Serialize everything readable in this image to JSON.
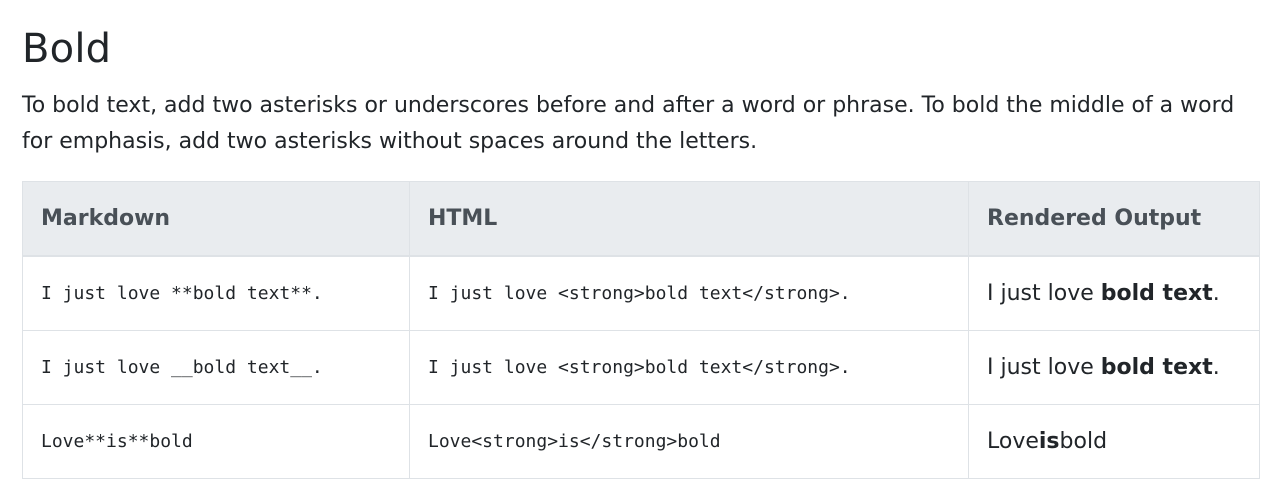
{
  "heading": "Bold",
  "intro": "To bold text, add two asterisks or underscores before and after a word or phrase. To bold the middle of a word for emphasis, add two asterisks without spaces around the letters.",
  "table": {
    "headers": [
      "Markdown",
      "HTML",
      "Rendered Output"
    ],
    "rows": [
      {
        "markdown": "I just love **bold text**.",
        "html": "I just love <strong>bold text</strong>.",
        "rendered": {
          "before": "I just love ",
          "bold": "bold text",
          "after": "."
        }
      },
      {
        "markdown": "I just love __bold text__.",
        "html": "I just love <strong>bold text</strong>.",
        "rendered": {
          "before": "I just love ",
          "bold": "bold text",
          "after": "."
        }
      },
      {
        "markdown": "Love**is**bold",
        "html": "Love<strong>is</strong>bold",
        "rendered": {
          "before": "Love",
          "bold": "is",
          "after": "bold"
        }
      }
    ]
  }
}
